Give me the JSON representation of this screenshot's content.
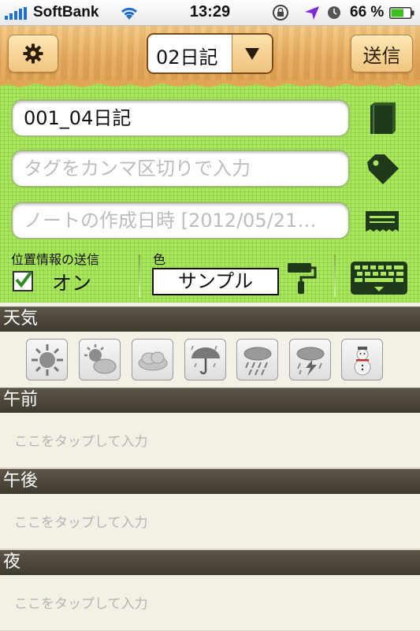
{
  "status_bar": {
    "carrier": "SoftBank",
    "time": "13:29",
    "battery_percent": "66 %",
    "battery_level": 0.66
  },
  "toolbar": {
    "notebook_selector": "02日記",
    "send_label": "送信"
  },
  "form": {
    "title_value": "001_04日記",
    "tags_placeholder": "タグをカンマ区切りで入力",
    "date_placeholder": "ノートの作成日時 [2012/05/21…",
    "location_label": "位置情報の送信",
    "location_checked": true,
    "location_value": "オン",
    "color_label": "色",
    "color_sample": "サンプル"
  },
  "sections": {
    "weather": {
      "title": "天気"
    },
    "morning": {
      "title": "午前",
      "placeholder": "ここをタップして入力"
    },
    "afternoon": {
      "title": "午後",
      "placeholder": "ここをタップして入力"
    },
    "night": {
      "title": "夜",
      "placeholder": "ここをタップして入力"
    }
  },
  "weather_icons": [
    "sunny-icon",
    "sun-and-cloud-icon",
    "cloudy-icon",
    "rain-umbrella-icon",
    "rain-icon",
    "thunderstorm-icon",
    "snowman-icon"
  ],
  "colors": {
    "form_bg": "#a9e85c",
    "section_header_bg": "#4d473c",
    "page_bg": "#f3f1e6"
  }
}
